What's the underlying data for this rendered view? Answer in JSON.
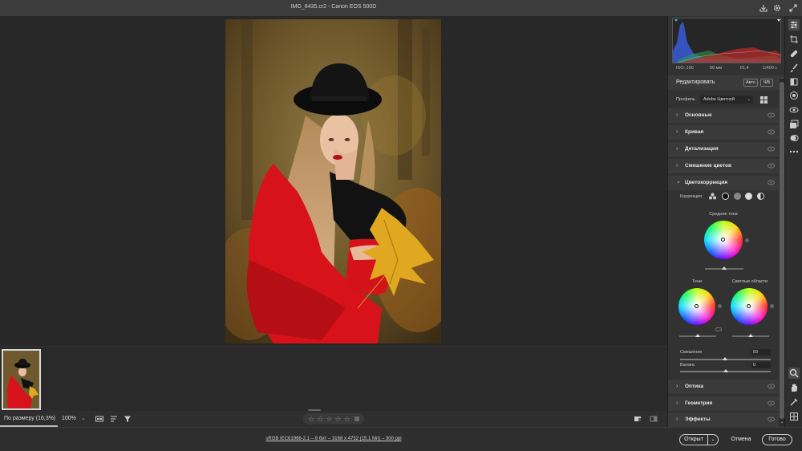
{
  "window": {
    "title": "IMG_8435.cr2  -  Canon EOS 500D",
    "icons": [
      "save-icon",
      "gear-icon",
      "expand-icon"
    ]
  },
  "histogram": {
    "exif": {
      "iso": "ISO: 100",
      "focal": "50 мм",
      "aperture": "f/1,4",
      "shutter": "1/400 с"
    }
  },
  "panel": {
    "edit_title": "Редактировать",
    "auto_label": "Авто",
    "bw_label": "Ч/Б",
    "profile_label": "Профиль",
    "profile_value": "Adobe Цветной",
    "sections_top": [
      {
        "name": "Основные",
        "expanded": false
      },
      {
        "name": "Кривая",
        "expanded": false
      },
      {
        "name": "Детализация",
        "expanded": false
      },
      {
        "name": "Смешение цветов",
        "expanded": false
      },
      {
        "name": "Цветокоррекция",
        "expanded": true
      }
    ],
    "color_grading": {
      "correction_label": "Коррекция",
      "midtones_label": "Средние тона",
      "shadows_label": "Тени",
      "highlights_label": "Светлые области",
      "blending_label": "Смешение",
      "blending_value": "50",
      "balance_label": "Баланс",
      "balance_value": "0"
    },
    "sections_bottom": [
      {
        "name": "Оптика",
        "expanded": false
      },
      {
        "name": "Геометрия",
        "expanded": false
      },
      {
        "name": "Эффекты",
        "expanded": false
      }
    ]
  },
  "bottom_bar": {
    "zoom_label": "По размеру (16,3%)",
    "zoom_percent": "100%",
    "rating": {
      "value": 0,
      "max": 5
    }
  },
  "status": {
    "info_link": "sRGB IEC61966-2.1 – 8 бит – 3168 x 4752 (15,1 Мп) – 300 ppi",
    "open_label": "Открыт",
    "cancel_label": "Отмена",
    "done_label": "Готово"
  },
  "colors": {
    "panel_bg": "#323232",
    "section_bg": "#3a3a3a",
    "coat_red": "#d8121a",
    "canvas_bg": "#282828"
  }
}
